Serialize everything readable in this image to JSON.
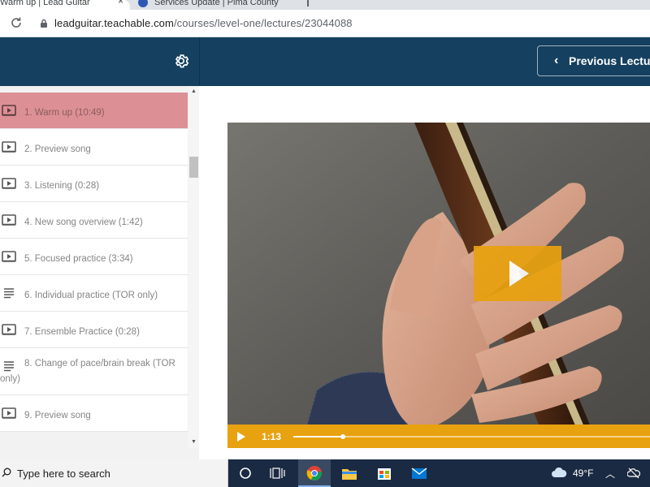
{
  "browser": {
    "tabs": [
      {
        "label": "Warm up | Lead Guitar",
        "active": true
      },
      {
        "label": "Services Update | Pima County",
        "active": false
      }
    ],
    "tab_close_glyph": "×",
    "url_host": "leadguitar.teachable.com",
    "url_path": "/courses/level-one/lectures/23044088"
  },
  "header": {
    "prev_label": "Previous Lecture",
    "colors": {
      "background": "#15405f"
    }
  },
  "sidebar": {
    "active_color": "#dc9095",
    "lectures": [
      {
        "title": "1. Warm up (10:49)",
        "icon": "video-icon",
        "active": true
      },
      {
        "title": "2. Preview song",
        "icon": "video-icon",
        "active": false
      },
      {
        "title": "3. Listening (0:28)",
        "icon": "video-icon",
        "active": false
      },
      {
        "title": "4. New song overview (1:42)",
        "icon": "video-icon",
        "active": false
      },
      {
        "title": "5. Focused practice (3:34)",
        "icon": "video-icon",
        "active": false
      },
      {
        "title": "6. Individual practice (TOR only)",
        "icon": "text-icon",
        "active": false
      },
      {
        "title": "7. Ensemble Practice (0:28)",
        "icon": "video-icon",
        "active": false
      },
      {
        "title": "8. Change of pace/brain break (TOR",
        "title_cont": "only)",
        "icon": "text-icon",
        "active": false
      },
      {
        "title": "9. Preview song",
        "icon": "video-icon",
        "active": false
      }
    ]
  },
  "player": {
    "current_time": "1:13",
    "progress": 0.14,
    "accent_color": "#e8a10f"
  },
  "taskbar": {
    "search_placeholder": "Type here to search",
    "temperature": "49°F"
  }
}
